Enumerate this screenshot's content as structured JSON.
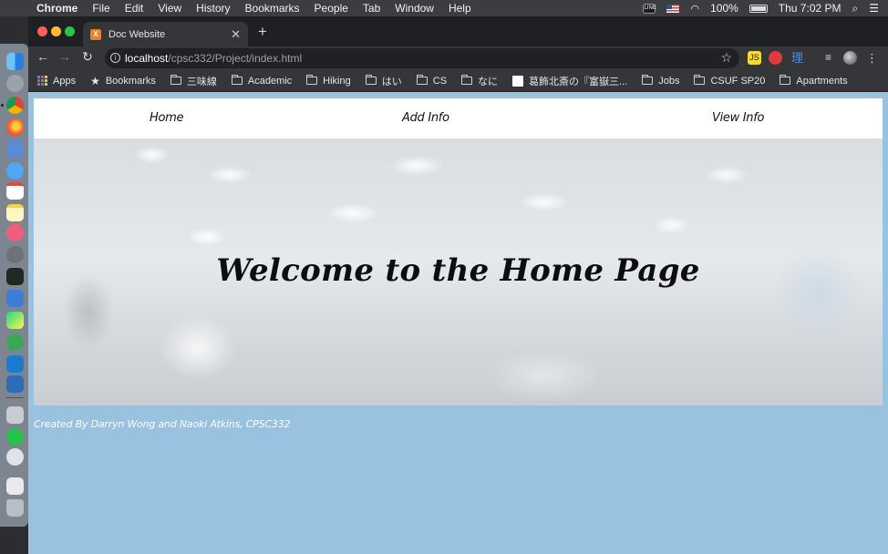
{
  "menubar": {
    "app_name": "Chrome",
    "items": [
      "File",
      "Edit",
      "View",
      "History",
      "Bookmarks",
      "People",
      "Tab",
      "Window",
      "Help"
    ],
    "battery": "100%",
    "clock": "Thu 7:02 PM"
  },
  "browser": {
    "tab_title": "Doc Website",
    "url_host": "localhost",
    "url_path": "/cpsc332/Project/index.html",
    "bookmarks": {
      "apps": "Apps",
      "items": [
        "Bookmarks",
        "三味線",
        "Academic",
        "Hiking",
        "はい",
        "CS",
        "なに",
        "葛飾北斎の『富嶽三...",
        "Jobs",
        "CSUF SP20",
        "Apartments"
      ]
    },
    "extensions": {
      "js_label": "JS",
      "kanji_label": "理"
    }
  },
  "page": {
    "nav": {
      "home": "Home",
      "add_info": "Add Info",
      "view_info": "View Info"
    },
    "hero_title": "Welcome to the Home Page",
    "footer_credit": "Created By Darryn Wong and Naoki Atkins, CPSC332"
  },
  "colors": {
    "page_background": "#99c1e0",
    "nav_background": "#ffffff",
    "browser_chrome": "#35363a"
  }
}
